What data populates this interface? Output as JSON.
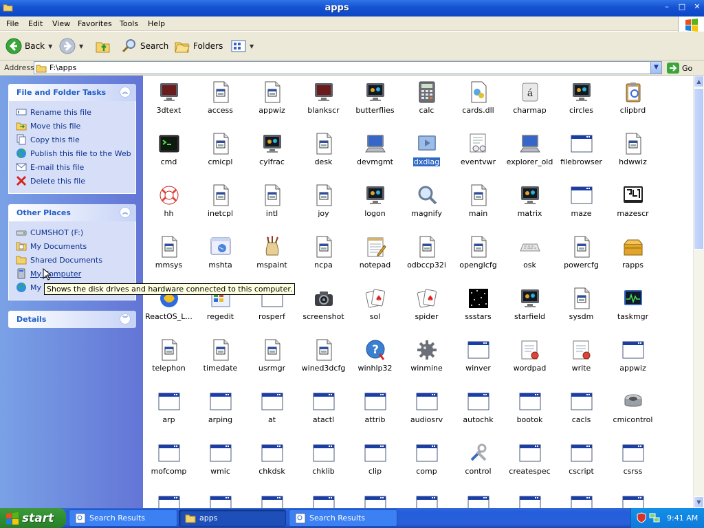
{
  "window": {
    "title": "apps"
  },
  "menu": [
    "File",
    "Edit",
    "View",
    "Favorites",
    "Tools",
    "Help"
  ],
  "toolbar": {
    "back": "Back",
    "search": "Search",
    "folders": "Folders"
  },
  "address": {
    "label": "Address",
    "value": "F:\\apps",
    "go": "Go"
  },
  "tasks_panel": {
    "title": "File and Folder Tasks",
    "items": [
      "Rename this file",
      "Move this file",
      "Copy this file",
      "Publish this file to the Web",
      "E-mail this file",
      "Delete this file"
    ]
  },
  "places_panel": {
    "title": "Other Places",
    "items": [
      "CUMSHOT (F:)",
      "My Documents",
      "Shared Documents",
      "My Computer",
      "My"
    ]
  },
  "details_panel": {
    "title": "Details"
  },
  "tooltip": "Shows the disk drives and hardware connected to this computer.",
  "files": [
    {
      "name": "3dtext",
      "icon": "monitor-icon"
    },
    {
      "name": "access",
      "icon": "app-file-icon"
    },
    {
      "name": "appwiz",
      "icon": "app-file-icon"
    },
    {
      "name": "blankscr",
      "icon": "monitor-icon"
    },
    {
      "name": "butterflies",
      "icon": "screensaver-icon"
    },
    {
      "name": "calc",
      "icon": "calculator-icon"
    },
    {
      "name": "cards.dll",
      "icon": "dll-icon"
    },
    {
      "name": "charmap",
      "icon": "charmap-icon"
    },
    {
      "name": "circles",
      "icon": "screensaver-icon"
    },
    {
      "name": "clipbrd",
      "icon": "clipboard-icon"
    },
    {
      "name": "cmd",
      "icon": "console-icon"
    },
    {
      "name": "cmicpl",
      "icon": "app-file-icon"
    },
    {
      "name": "cylfrac",
      "icon": "screensaver-icon"
    },
    {
      "name": "desk",
      "icon": "app-file-icon"
    },
    {
      "name": "devmgmt",
      "icon": "computer-icon"
    },
    {
      "name": "dxdiag",
      "icon": "dxdiag-icon"
    },
    {
      "name": "eventvwr",
      "icon": "event-viewer-icon"
    },
    {
      "name": "explorer_old",
      "icon": "computer-icon"
    },
    {
      "name": "filebrowser",
      "icon": "window-icon"
    },
    {
      "name": "hdwwiz",
      "icon": "app-file-icon"
    },
    {
      "name": "hh",
      "icon": "lifebuoy-icon"
    },
    {
      "name": "inetcpl",
      "icon": "app-file-icon"
    },
    {
      "name": "intl",
      "icon": "app-file-icon"
    },
    {
      "name": "joy",
      "icon": "app-file-icon"
    },
    {
      "name": "logon",
      "icon": "screensaver-icon"
    },
    {
      "name": "magnify",
      "icon": "magnifier-icon"
    },
    {
      "name": "main",
      "icon": "app-file-icon"
    },
    {
      "name": "matrix",
      "icon": "screensaver-icon"
    },
    {
      "name": "maze",
      "icon": "window-icon"
    },
    {
      "name": "mazescr",
      "icon": "maze-icon"
    },
    {
      "name": "mmsys",
      "icon": "app-file-icon"
    },
    {
      "name": "mshta",
      "icon": "mshta-icon"
    },
    {
      "name": "mspaint",
      "icon": "paint-icon"
    },
    {
      "name": "ncpa",
      "icon": "app-file-icon"
    },
    {
      "name": "notepad",
      "icon": "notepad-icon"
    },
    {
      "name": "odbccp32i",
      "icon": "app-file-icon"
    },
    {
      "name": "openglcfg",
      "icon": "app-file-icon"
    },
    {
      "name": "osk",
      "icon": "keyboard-icon"
    },
    {
      "name": "powercfg",
      "icon": "app-file-icon"
    },
    {
      "name": "rapps",
      "icon": "package-icon"
    },
    {
      "name": "ReactOS_L...",
      "icon": "reactos-icon"
    },
    {
      "name": "regedit",
      "icon": "registry-icon"
    },
    {
      "name": "rosperf",
      "icon": "window-icon"
    },
    {
      "name": "screenshot",
      "icon": "camera-icon"
    },
    {
      "name": "sol",
      "icon": "cards-icon"
    },
    {
      "name": "spider",
      "icon": "cards-icon"
    },
    {
      "name": "ssstars",
      "icon": "starfield-icon"
    },
    {
      "name": "starfield",
      "icon": "screensaver-icon"
    },
    {
      "name": "sysdm",
      "icon": "app-file-icon"
    },
    {
      "name": "taskmgr",
      "icon": "task-manager-icon"
    },
    {
      "name": "telephon",
      "icon": "app-file-icon"
    },
    {
      "name": "timedate",
      "icon": "app-file-icon"
    },
    {
      "name": "usrmgr",
      "icon": "app-file-icon"
    },
    {
      "name": "wined3dcfg",
      "icon": "app-file-icon"
    },
    {
      "name": "winhlp32",
      "icon": "help-icon"
    },
    {
      "name": "winmine",
      "icon": "mine-icon"
    },
    {
      "name": "winver",
      "icon": "window-icon"
    },
    {
      "name": "wordpad",
      "icon": "wordpad-icon"
    },
    {
      "name": "write",
      "icon": "wordpad-icon"
    },
    {
      "name": "appwiz",
      "icon": "window-icon"
    },
    {
      "name": "arp",
      "icon": "window-icon"
    },
    {
      "name": "arping",
      "icon": "window-icon"
    },
    {
      "name": "at",
      "icon": "window-icon"
    },
    {
      "name": "atactl",
      "icon": "window-icon"
    },
    {
      "name": "attrib",
      "icon": "window-icon"
    },
    {
      "name": "audiosrv",
      "icon": "window-icon"
    },
    {
      "name": "autochk",
      "icon": "window-icon"
    },
    {
      "name": "bootok",
      "icon": "window-icon"
    },
    {
      "name": "cacls",
      "icon": "window-icon"
    },
    {
      "name": "cmicontrol",
      "icon": "speaker-icon"
    },
    {
      "name": "mofcomp",
      "icon": "window-icon"
    },
    {
      "name": "wmic",
      "icon": "window-icon"
    },
    {
      "name": "chkdsk",
      "icon": "window-icon"
    },
    {
      "name": "chklib",
      "icon": "window-icon"
    },
    {
      "name": "clip",
      "icon": "window-icon"
    },
    {
      "name": "comp",
      "icon": "window-icon"
    },
    {
      "name": "control",
      "icon": "tools-icon"
    },
    {
      "name": "createspec",
      "icon": "window-icon"
    },
    {
      "name": "cscript",
      "icon": "window-icon"
    },
    {
      "name": "csrss",
      "icon": "window-icon"
    },
    {
      "name": "",
      "icon": "window-icon"
    },
    {
      "name": "",
      "icon": "window-icon"
    },
    {
      "name": "",
      "icon": "window-icon"
    },
    {
      "name": "",
      "icon": "window-icon"
    },
    {
      "name": "",
      "icon": "window-icon"
    },
    {
      "name": "",
      "icon": "window-icon"
    },
    {
      "name": "",
      "icon": "window-icon"
    },
    {
      "name": "",
      "icon": "window-icon"
    },
    {
      "name": "",
      "icon": "window-icon"
    },
    {
      "name": "",
      "icon": "window-icon"
    }
  ],
  "selected_file": "dxdiag",
  "taskbar": {
    "start": "start",
    "tasks": [
      "Search Results",
      "apps",
      "Search Results"
    ],
    "clock": "9:41 AM"
  },
  "colors": {
    "selection": "#316ac5",
    "titlebar": "#0b46c6",
    "sidebar": "#6375d6",
    "start": "#2f8e2f"
  }
}
